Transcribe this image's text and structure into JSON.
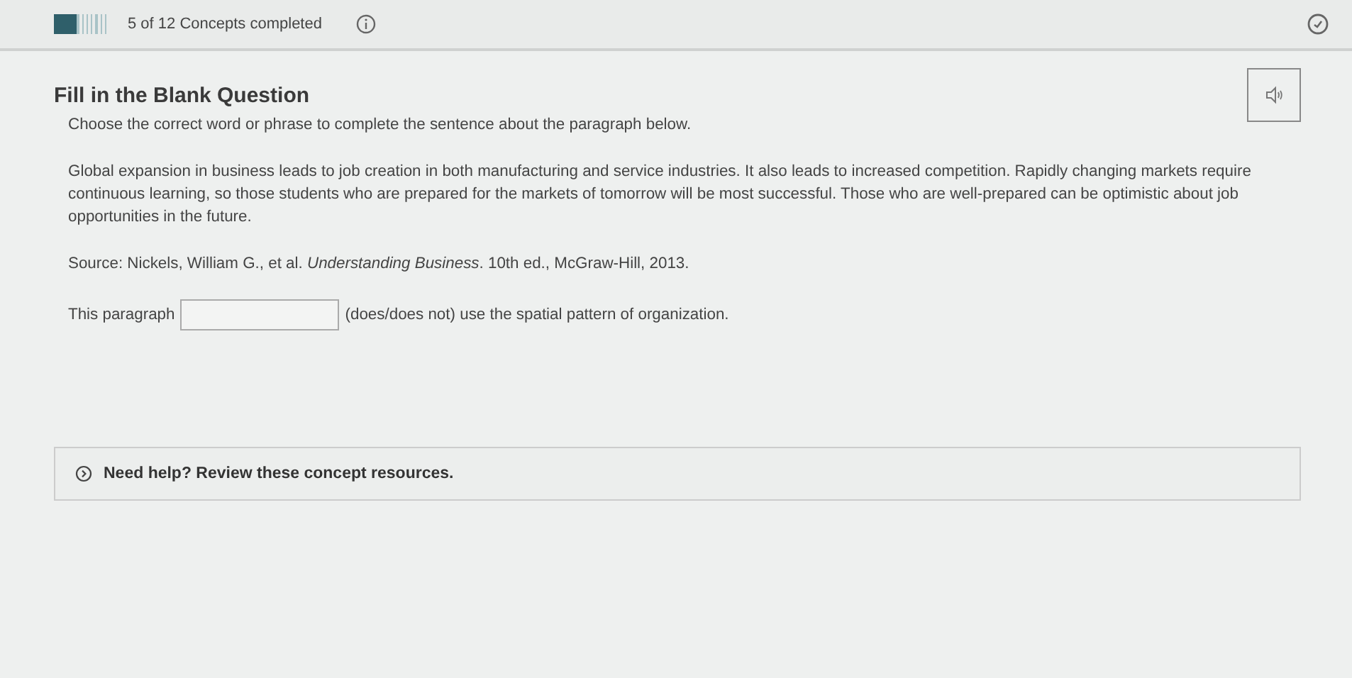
{
  "header": {
    "progress": {
      "level": 0.4167
    },
    "progress_text": "5 of 12 Concepts completed"
  },
  "question": {
    "title": "Fill in the Blank Question",
    "instruction": "Choose the correct word or phrase to complete the sentence about the paragraph below.",
    "paragraph": "Global expansion in business leads to job creation in both manufacturing and service industries. It also leads to increased competition. Rapidly changing markets require continuous learning, so those students who are prepared for the markets of tomorrow will be most successful. Those who are well-prepared can be optimistic about job opportunities in the future.",
    "source": "Source: Nickels, William G., et al. *Understanding Business*. 10th ed., McGraw-Hill, 2013.",
    "sentence_before": "This paragraph",
    "sentence_after": "(does/does not) use the spatial pattern of organization."
  },
  "help": {
    "text": "Need help? Review these concept resources.",
    "expanded": false
  }
}
